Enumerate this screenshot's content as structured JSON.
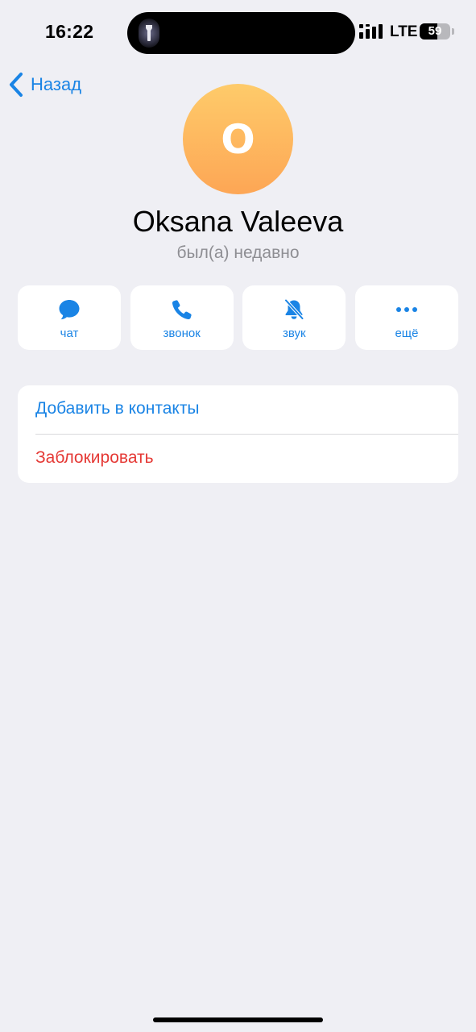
{
  "status_bar": {
    "time": "16:22",
    "network": "LTE",
    "battery_level": "59",
    "battery_fraction": 0.59
  },
  "nav": {
    "back_label": "Назад"
  },
  "profile": {
    "avatar_letter": "O",
    "name": "Oksana Valeeva",
    "last_seen": "был(а) недавно",
    "avatar_gradient": [
      "#FECB6A",
      "#FDA655"
    ]
  },
  "actions": [
    {
      "label": "чат",
      "icon": "chat-bubble-icon"
    },
    {
      "label": "звонок",
      "icon": "phone-icon"
    },
    {
      "label": "звук",
      "icon": "bell-slash-icon"
    },
    {
      "label": "ещё",
      "icon": "more-dots-icon"
    }
  ],
  "list": {
    "add_contact": "Добавить в контакты",
    "block": "Заблокировать"
  },
  "colors": {
    "accent": "#1A84E5",
    "destructive": "#E53935",
    "background": "#EFEFF4",
    "secondary_text": "#8E8E93"
  }
}
